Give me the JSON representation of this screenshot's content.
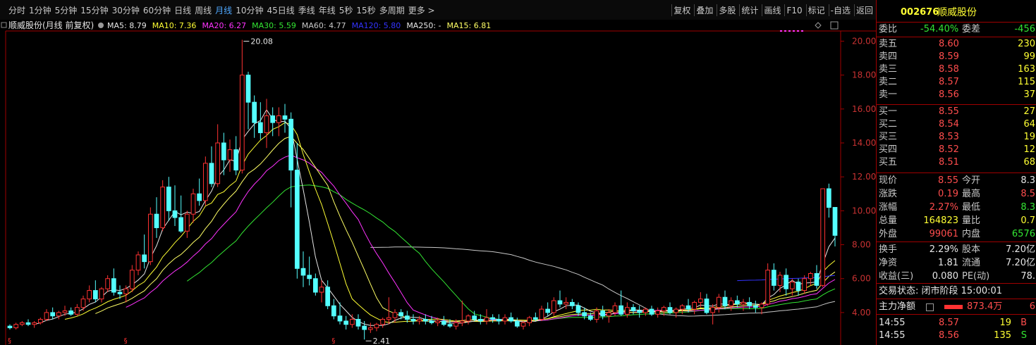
{
  "toolbar": {
    "periods": [
      "分时",
      "1分钟",
      "5分钟",
      "15分钟",
      "30分钟",
      "60分钟",
      "日线",
      "周线",
      "月线",
      "10分钟",
      "45日线",
      "季线",
      "年线",
      "5秒",
      "15秒",
      "多周期",
      "更多 >"
    ],
    "active_period": "月线",
    "right_tools": [
      "复权",
      "叠加",
      "多股",
      "统计",
      "画线",
      "F10",
      "标记",
      "-自选",
      "返回"
    ]
  },
  "legend": {
    "stock_label": "顺威股份(月线 前复权)",
    "items": [
      {
        "text": "MA5: 8.79",
        "color": "#e6e6e6"
      },
      {
        "text": "MA10: 7.36",
        "color": "#ffff33"
      },
      {
        "text": "MA20: 6.27",
        "color": "#ff33ff"
      },
      {
        "text": "MA30: 5.59",
        "color": "#33e633"
      },
      {
        "text": "MA60: 4.77",
        "color": "#c8c8c8"
      },
      {
        "text": "MA120: 5.80",
        "color": "#3333ff"
      },
      {
        "text": "MA250: -",
        "color": "#e6e6e6"
      },
      {
        "text": "MA15: 6.81",
        "color": "#ffff66"
      }
    ]
  },
  "chart_data": {
    "type": "candlestick",
    "y_ticks": [
      "20.00",
      "18.00",
      "16.00",
      "14.00",
      "12.00",
      "10.00",
      "8.00",
      "6.00",
      "4.00"
    ],
    "ylim": [
      3.0,
      20.6
    ],
    "high_label": "20.08",
    "low_label": "2.41",
    "grid": false,
    "ohlc": [
      [
        3.2,
        3.3,
        3.0,
        3.1
      ],
      [
        3.1,
        3.4,
        3.0,
        3.3
      ],
      [
        3.3,
        3.5,
        3.2,
        3.4
      ],
      [
        3.4,
        3.6,
        3.2,
        3.3
      ],
      [
        3.3,
        3.5,
        3.1,
        3.4
      ],
      [
        3.4,
        3.7,
        3.3,
        3.6
      ],
      [
        3.6,
        4.2,
        3.5,
        4.0
      ],
      [
        4.0,
        4.3,
        3.6,
        3.8
      ],
      [
        3.8,
        4.1,
        3.6,
        4.0
      ],
      [
        4.0,
        4.4,
        3.8,
        4.1
      ],
      [
        4.1,
        4.3,
        3.8,
        3.9
      ],
      [
        3.9,
        4.5,
        3.8,
        4.3
      ],
      [
        4.3,
        5.0,
        4.1,
        4.8
      ],
      [
        4.8,
        5.6,
        4.6,
        5.3
      ],
      [
        5.3,
        5.9,
        4.6,
        4.8
      ],
      [
        4.8,
        5.5,
        4.6,
        5.4
      ],
      [
        5.4,
        6.2,
        5.2,
        6.0
      ],
      [
        6.0,
        6.6,
        5.0,
        5.2
      ],
      [
        5.2,
        5.6,
        4.8,
        5.1
      ],
      [
        5.1,
        5.6,
        4.6,
        5.4
      ],
      [
        5.4,
        6.8,
        5.2,
        6.5
      ],
      [
        6.5,
        7.6,
        6.2,
        7.4
      ],
      [
        7.4,
        8.6,
        6.6,
        7.0
      ],
      [
        7.0,
        10.2,
        6.8,
        9.8
      ],
      [
        9.8,
        10.8,
        8.4,
        9.0
      ],
      [
        9.0,
        11.8,
        8.8,
        11.4
      ],
      [
        11.4,
        12.0,
        9.4,
        10.0
      ],
      [
        10.0,
        11.5,
        9.1,
        9.6
      ],
      [
        9.6,
        10.9,
        8.7,
        8.8
      ],
      [
        8.8,
        10.0,
        8.4,
        9.8
      ],
      [
        9.8,
        11.3,
        9.3,
        11.0
      ],
      [
        11.0,
        11.9,
        10.3,
        10.6
      ],
      [
        10.6,
        13.2,
        10.3,
        12.8
      ],
      [
        12.8,
        13.8,
        11.4,
        11.6
      ],
      [
        11.6,
        15.1,
        11.4,
        14.0
      ],
      [
        14.0,
        14.6,
        12.1,
        13.0
      ],
      [
        13.0,
        14.2,
        12.3,
        13.6
      ],
      [
        13.6,
        14.4,
        12.1,
        12.4
      ],
      [
        12.4,
        20.08,
        12.2,
        18.0
      ],
      [
        18.0,
        18.2,
        14.8,
        16.4
      ],
      [
        16.4,
        16.8,
        14.3,
        15.2
      ],
      [
        15.2,
        16.4,
        14.2,
        14.6
      ],
      [
        14.6,
        16.6,
        13.7,
        15.6
      ],
      [
        15.6,
        16.1,
        14.4,
        15.2
      ],
      [
        15.2,
        16.1,
        14.4,
        15.6
      ],
      [
        15.6,
        16.3,
        14.6,
        15.4
      ],
      [
        15.4,
        15.8,
        10.2,
        12.4
      ],
      [
        12.4,
        14.0,
        6.0,
        6.6
      ],
      [
        6.6,
        7.6,
        5.5,
        6.2
      ],
      [
        6.2,
        7.3,
        5.6,
        6.0
      ],
      [
        6.0,
        6.3,
        5.0,
        5.2
      ],
      [
        5.2,
        5.9,
        4.6,
        5.5
      ],
      [
        5.5,
        5.9,
        4.2,
        4.4
      ],
      [
        4.4,
        4.8,
        3.6,
        3.8
      ],
      [
        3.8,
        4.6,
        3.3,
        3.5
      ],
      [
        3.5,
        3.8,
        3.0,
        3.3
      ],
      [
        3.3,
        3.9,
        3.1,
        3.6
      ],
      [
        3.6,
        3.9,
        3.0,
        3.2
      ],
      [
        3.2,
        3.5,
        2.41,
        3.0
      ],
      [
        3.0,
        3.4,
        2.8,
        3.1
      ],
      [
        3.1,
        3.4,
        2.9,
        3.3
      ],
      [
        3.3,
        3.7,
        3.1,
        3.6
      ],
      [
        3.6,
        4.9,
        3.3,
        3.7
      ],
      [
        3.7,
        4.2,
        3.4,
        4.0
      ],
      [
        4.0,
        4.2,
        3.6,
        3.8
      ],
      [
        3.8,
        4.1,
        3.4,
        3.6
      ],
      [
        3.6,
        3.9,
        3.3,
        3.5
      ],
      [
        3.5,
        3.8,
        3.3,
        3.6
      ],
      [
        3.6,
        3.9,
        3.3,
        3.5
      ],
      [
        3.5,
        3.8,
        3.3,
        3.4
      ],
      [
        3.4,
        3.7,
        3.2,
        3.5
      ],
      [
        3.5,
        3.8,
        3.2,
        3.3
      ],
      [
        3.3,
        3.6,
        3.1,
        3.2
      ],
      [
        3.2,
        3.6,
        3.0,
        3.4
      ],
      [
        3.4,
        4.7,
        3.2,
        3.5
      ],
      [
        3.5,
        3.9,
        3.3,
        3.8
      ],
      [
        3.8,
        4.1,
        3.5,
        3.6
      ],
      [
        3.6,
        3.9,
        3.3,
        3.5
      ],
      [
        3.5,
        4.2,
        3.3,
        3.7
      ],
      [
        3.7,
        3.9,
        3.4,
        3.6
      ],
      [
        3.6,
        3.9,
        3.3,
        3.5
      ],
      [
        3.5,
        3.9,
        3.3,
        3.7
      ],
      [
        3.7,
        4.0,
        3.4,
        3.5
      ],
      [
        3.5,
        3.7,
        3.1,
        3.2
      ],
      [
        3.2,
        3.5,
        3.0,
        3.4
      ],
      [
        3.4,
        3.8,
        3.2,
        3.7
      ],
      [
        3.7,
        4.0,
        3.5,
        3.6
      ],
      [
        3.6,
        4.4,
        3.5,
        4.2
      ],
      [
        4.2,
        4.6,
        3.8,
        4.0
      ],
      [
        4.0,
        4.9,
        3.8,
        4.7
      ],
      [
        4.7,
        5.3,
        4.3,
        4.5
      ],
      [
        4.5,
        4.9,
        4.2,
        4.6
      ],
      [
        4.6,
        4.8,
        4.2,
        4.4
      ],
      [
        4.4,
        4.6,
        3.8,
        4.0
      ],
      [
        4.0,
        4.3,
        3.6,
        3.8
      ],
      [
        3.8,
        4.0,
        3.5,
        3.6
      ],
      [
        3.6,
        4.3,
        3.4,
        4.1
      ],
      [
        4.1,
        4.4,
        3.6,
        3.8
      ],
      [
        3.8,
        4.2,
        3.4,
        4.0
      ],
      [
        4.0,
        4.6,
        3.8,
        4.4
      ],
      [
        4.4,
        5.3,
        3.8,
        3.9
      ],
      [
        3.9,
        4.6,
        3.7,
        4.3
      ],
      [
        4.3,
        4.5,
        3.9,
        4.1
      ],
      [
        4.1,
        4.4,
        3.7,
        4.0
      ],
      [
        4.0,
        4.3,
        3.8,
        4.2
      ],
      [
        4.2,
        4.4,
        3.8,
        3.9
      ],
      [
        3.9,
        4.3,
        3.7,
        4.1
      ],
      [
        4.1,
        4.4,
        3.8,
        4.3
      ],
      [
        4.3,
        4.6,
        3.9,
        4.0
      ],
      [
        4.0,
        4.3,
        3.7,
        4.2
      ],
      [
        4.2,
        4.5,
        3.9,
        4.4
      ],
      [
        4.4,
        4.8,
        4.0,
        4.2
      ],
      [
        4.2,
        4.7,
        3.9,
        4.6
      ],
      [
        4.6,
        5.2,
        4.3,
        4.8
      ],
      [
        4.8,
        5.1,
        3.9,
        4.0
      ],
      [
        4.0,
        4.5,
        3.3,
        4.3
      ],
      [
        4.3,
        5.1,
        4.0,
        4.9
      ],
      [
        4.9,
        5.3,
        4.2,
        4.4
      ],
      [
        4.4,
        4.9,
        4.1,
        4.7
      ],
      [
        4.7,
        5.0,
        4.3,
        4.5
      ],
      [
        4.5,
        4.8,
        4.1,
        4.6
      ],
      [
        4.6,
        4.9,
        4.2,
        4.4
      ],
      [
        4.4,
        4.7,
        4.0,
        4.3
      ],
      [
        4.3,
        4.6,
        3.9,
        4.5
      ],
      [
        4.5,
        6.9,
        4.4,
        6.5
      ],
      [
        6.5,
        6.9,
        5.3,
        5.6
      ],
      [
        5.6,
        6.4,
        5.2,
        6.2
      ],
      [
        6.2,
        6.6,
        5.0,
        5.4
      ],
      [
        5.4,
        6.0,
        5.0,
        5.8
      ],
      [
        5.8,
        6.0,
        5.0,
        5.3
      ],
      [
        5.3,
        6.2,
        5.1,
        6.0
      ],
      [
        6.0,
        6.4,
        5.6,
        6.3
      ],
      [
        6.3,
        6.8,
        5.4,
        5.6
      ],
      [
        5.6,
        11.3,
        5.5,
        11.3
      ],
      [
        11.3,
        11.6,
        9.6,
        10.2
      ],
      [
        10.2,
        10.2,
        7.9,
        8.55
      ]
    ]
  },
  "side": {
    "code": "002676",
    "name": "顺威股份",
    "weibi": {
      "label": "委比",
      "value": "-54.40%",
      "label2": "委差",
      "value2": "-456"
    },
    "sells": [
      {
        "label": "卖五",
        "price": "8.60",
        "vol": "230"
      },
      {
        "label": "卖四",
        "price": "8.59",
        "vol": "99"
      },
      {
        "label": "卖三",
        "price": "8.58",
        "vol": "163"
      },
      {
        "label": "卖二",
        "price": "8.57",
        "vol": "115"
      },
      {
        "label": "卖一",
        "price": "8.56",
        "vol": "37"
      }
    ],
    "buys": [
      {
        "label": "买一",
        "price": "8.55",
        "vol": "27"
      },
      {
        "label": "买二",
        "price": "8.54",
        "vol": "64"
      },
      {
        "label": "买三",
        "price": "8.53",
        "vol": "19"
      },
      {
        "label": "买四",
        "price": "8.52",
        "vol": "12"
      },
      {
        "label": "买五",
        "price": "8.51",
        "vol": "68"
      }
    ],
    "quote": [
      {
        "l1": "现价",
        "v1": "8.55",
        "c1": "red",
        "l2": "今开",
        "v2": "8.3",
        "c2": "white"
      },
      {
        "l1": "涨跌",
        "v1": "0.19",
        "c1": "red",
        "l2": "最高",
        "v2": "8.5",
        "c2": "red"
      },
      {
        "l1": "涨幅",
        "v1": "2.27%",
        "c1": "red",
        "l2": "最低",
        "v2": "8.3",
        "c2": "green"
      },
      {
        "l1": "总量",
        "v1": "164823",
        "c1": "yellow",
        "l2": "量比",
        "v2": "0.7",
        "c2": "yellow"
      },
      {
        "l1": "外盘",
        "v1": "99061",
        "c1": "red",
        "l2": "内盘",
        "v2": "6576",
        "c2": "green"
      }
    ],
    "fund": [
      {
        "l1": "换手",
        "v1": "2.29%",
        "l2": "股本",
        "v2": "7.20亿"
      },
      {
        "l1": "净资",
        "v1": "1.81",
        "l2": "流通",
        "v2": "7.20亿"
      },
      {
        "l1": "收益(三)",
        "v1": "0.080",
        "l2": "PE(动)",
        "v2": "78."
      }
    ],
    "status": "交易状态: 闭市阶段 15:00:01",
    "main_flow": {
      "label": "主力净额",
      "value": "873.4万",
      "extra": "6"
    },
    "ticks": [
      {
        "time": "14:55",
        "price": "8.57",
        "vol": "19",
        "side": "B"
      },
      {
        "time": "14:55",
        "price": "8.56",
        "vol": "135",
        "side": "S"
      }
    ]
  }
}
